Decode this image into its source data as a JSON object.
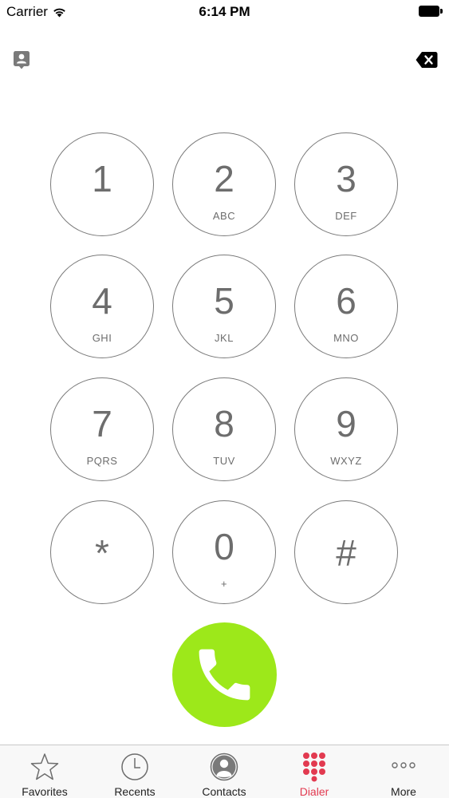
{
  "status_bar": {
    "carrier": "Carrier",
    "time": "6:14 PM"
  },
  "top_actions": {
    "contacts_icon": "contact-card-icon",
    "delete_icon": "backspace-icon"
  },
  "keypad": {
    "keys": [
      {
        "digit": "1",
        "letters": ""
      },
      {
        "digit": "2",
        "letters": "ABC"
      },
      {
        "digit": "3",
        "letters": "DEF"
      },
      {
        "digit": "4",
        "letters": "GHI"
      },
      {
        "digit": "5",
        "letters": "JKL"
      },
      {
        "digit": "6",
        "letters": "MNO"
      },
      {
        "digit": "7",
        "letters": "PQRS"
      },
      {
        "digit": "8",
        "letters": "TUV"
      },
      {
        "digit": "9",
        "letters": "WXYZ"
      },
      {
        "digit": "*",
        "letters": ""
      },
      {
        "digit": "0",
        "letters": "+"
      },
      {
        "digit": "#",
        "letters": ""
      }
    ]
  },
  "call_button": {
    "icon": "phone-icon",
    "color": "#9de81a"
  },
  "tab_bar": {
    "active_color": "#e23a50",
    "tabs": [
      {
        "label": "Favorites",
        "icon": "star-icon",
        "active": false
      },
      {
        "label": "Recents",
        "icon": "clock-icon",
        "active": false
      },
      {
        "label": "Contacts",
        "icon": "person-icon",
        "active": false
      },
      {
        "label": "Dialer",
        "icon": "dialpad-icon",
        "active": true
      },
      {
        "label": "More",
        "icon": "more-icon",
        "active": false
      }
    ]
  }
}
